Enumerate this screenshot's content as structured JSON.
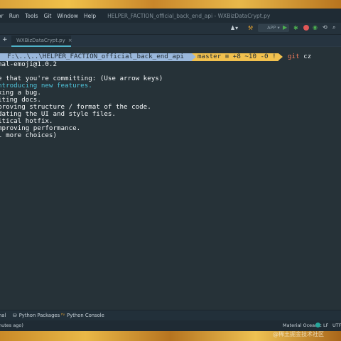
{
  "menubar": {
    "items": [
      "or",
      "Run",
      "Tools",
      "Git",
      "Window",
      "Help"
    ],
    "title": "HELPER_FACTION_official_back_end_api - WXBizDataCrypt.py"
  },
  "toolbar": {
    "config_label": "APP"
  },
  "tabs": [
    {
      "label": "WXBizDataCrypt.py",
      "close": "×"
    }
  ],
  "terminal": {
    "prompt_path": "F:\\..\\..\\HELPER_FACTION_official_back_end_api",
    "prompt_branch": "master ≡ +8 ~10 -0 !",
    "prompt_command_git": "git",
    "prompt_command_rest": " cz",
    "lines": [
      {
        "text": "nal-emoji@1.0.2",
        "color": "white"
      },
      {
        "text": "",
        "color": "white"
      },
      {
        "text": "e that you're committing: (Use arrow keys)",
        "color": "white"
      },
      {
        "text": "ntroducing new features.",
        "color": "cyan"
      },
      {
        "text": "xing a bug.",
        "color": "white"
      },
      {
        "text": "iting docs.",
        "color": "white"
      },
      {
        "text": "proving structure / format of the code.",
        "color": "white"
      },
      {
        "text": "dating the UI and style files.",
        "color": "white"
      },
      {
        "text": "itical hotfix.",
        "color": "white"
      },
      {
        "text": "mproving performance.",
        "color": "white"
      },
      {
        "text": "l more choices)",
        "color": "white"
      }
    ]
  },
  "bottom_tools": {
    "terminal": "nal",
    "python_packages": "Python Packages",
    "python_console": "Python Console"
  },
  "statusbar": {
    "left": "nutes ago)",
    "theme": "Material Oceanic",
    "line_ending": "LF",
    "encoding": "UTF"
  },
  "watermark": "@稀土掘金技术社区"
}
